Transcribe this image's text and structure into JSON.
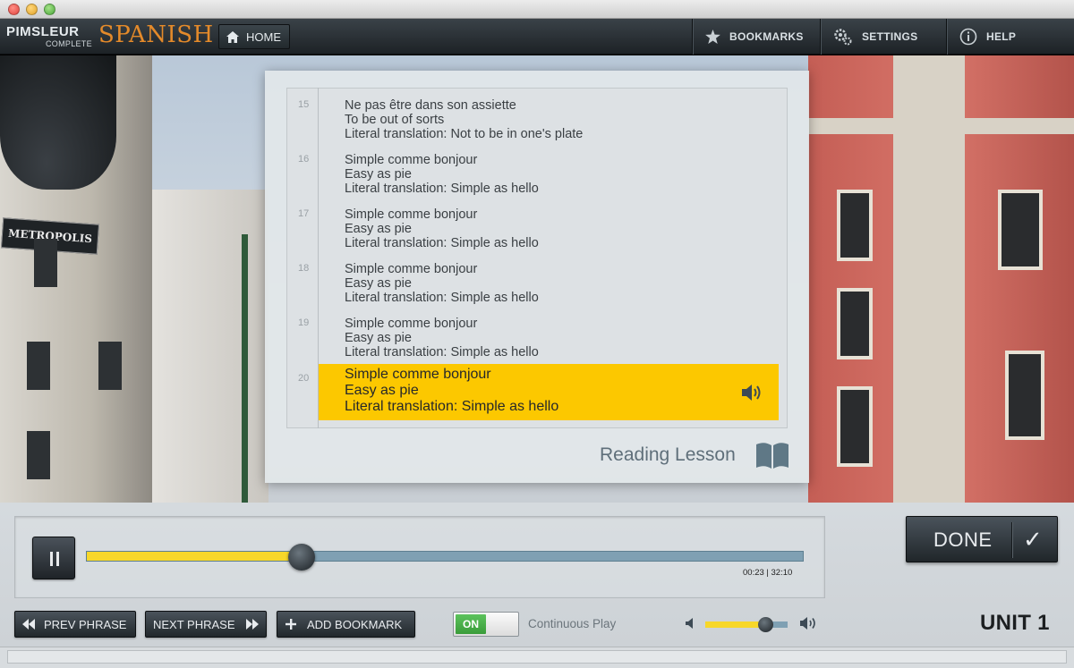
{
  "window": {
    "title": ""
  },
  "header": {
    "brand_top": "PIMSLEUR",
    "brand_sub": "COMPLETE",
    "brand_language": "SPANISH",
    "home_label": "HOME",
    "nav": [
      {
        "label": "BOOKMARKS",
        "icon": "star-icon"
      },
      {
        "label": "SETTINGS",
        "icon": "gear-icon"
      },
      {
        "label": "HELP",
        "icon": "info-icon"
      }
    ]
  },
  "background": {
    "sign_text": "METROPOLIS"
  },
  "reading": {
    "entries": [
      {
        "num": "15",
        "line1": "Ne pas être dans son assiette",
        "line2": "To be out of sorts",
        "line3": "Literal translation: Not to be in one's plate",
        "active": false
      },
      {
        "num": "16",
        "line1": "Simple comme bonjour",
        "line2": "Easy as pie",
        "line3": "Literal translation: Simple as hello",
        "active": false
      },
      {
        "num": "17",
        "line1": "Simple comme bonjour",
        "line2": "Easy as pie",
        "line3": "Literal translation: Simple as hello",
        "active": false
      },
      {
        "num": "18",
        "line1": "Simple comme bonjour",
        "line2": "Easy as pie",
        "line3": "Literal translation: Simple as hello",
        "active": false
      },
      {
        "num": "19",
        "line1": "Simple comme bonjour",
        "line2": "Easy as pie",
        "line3": "Literal translation: Simple as hello",
        "active": false
      },
      {
        "num": "20",
        "line1": "Simple comme bonjour",
        "line2": "Easy as pie",
        "line3": "Literal translation: Simple as hello",
        "active": true
      }
    ],
    "lesson_label": "Reading Lesson"
  },
  "player": {
    "progress_fraction": 0.3,
    "time_text": "00:23 | 32:10",
    "done_label": "DONE",
    "prev_label": "PREV PHRASE",
    "next_label": "NEXT PHRASE",
    "bookmark_label": "ADD BOOKMARK",
    "toggle_label": "ON",
    "continuous_label": "Continuous Play",
    "volume_fraction": 0.73,
    "unit_label": "UNIT 1"
  },
  "colors": {
    "accent": "#fcc800",
    "brand_orange": "#e48a2a",
    "toggle_on": "#4aad4a"
  }
}
